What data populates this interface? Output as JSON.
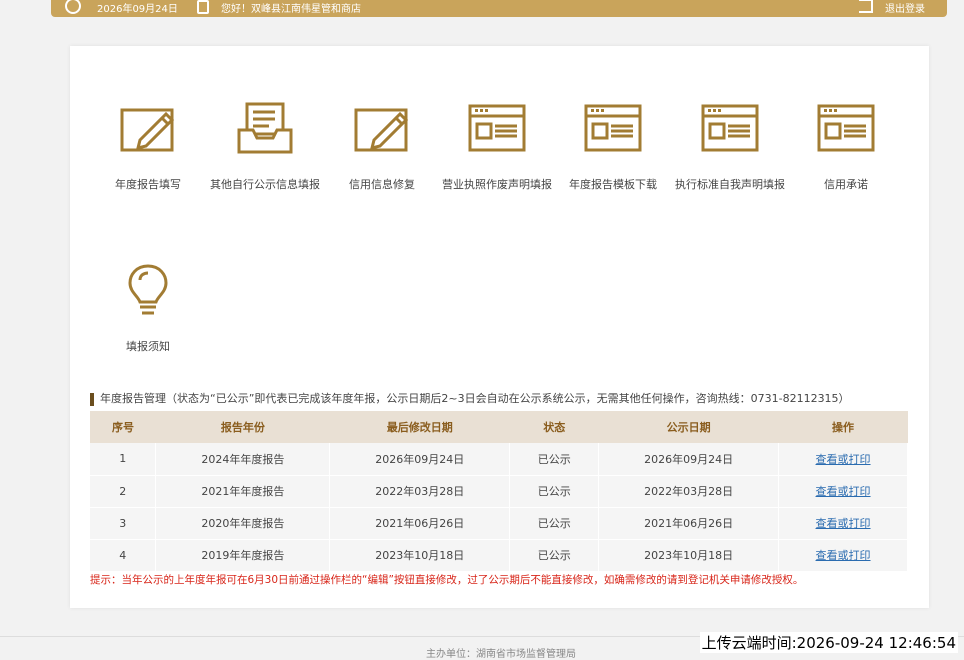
{
  "topbar": {
    "date": "2026年09月24日",
    "welcome": "您好！双峰县江南伟星管和商店",
    "logout": "退出登录"
  },
  "menu": [
    {
      "label": "年度报告填写",
      "icon": "edit-icon"
    },
    {
      "label": "其他自行公示信息填报",
      "icon": "inbox-icon"
    },
    {
      "label": "信用信息修复",
      "icon": "edit-icon"
    },
    {
      "label": "营业执照作废声明填报",
      "icon": "form-window-icon"
    },
    {
      "label": "年度报告模板下载",
      "icon": "form-window-icon"
    },
    {
      "label": "执行标准自我声明填报",
      "icon": "form-window-icon"
    },
    {
      "label": "信用承诺",
      "icon": "form-window-icon"
    },
    {
      "label": "填报须知",
      "icon": "lightbulb-icon"
    }
  ],
  "section_title": "年度报告管理（状态为“已公示”即代表已完成该年度年报，公示日期后2~3日会自动在公示系统公示，无需其他任何操作，咨询热线：0731-82112315）",
  "table": {
    "headers": [
      "序号",
      "报告年份",
      "最后修改日期",
      "状态",
      "公示日期",
      "操作"
    ],
    "rows": [
      [
        "1",
        "2024年年度报告",
        "2026年09月24日",
        "已公示",
        "2026年09月24日",
        "查看或打印"
      ],
      [
        "2",
        "2021年年度报告",
        "2022年03月28日",
        "已公示",
        "2022年03月28日",
        "查看或打印"
      ],
      [
        "3",
        "2020年年度报告",
        "2021年06月26日",
        "已公示",
        "2021年06月26日",
        "查看或打印"
      ],
      [
        "4",
        "2019年年度报告",
        "2023年10月18日",
        "已公示",
        "2023年10月18日",
        "查看或打印"
      ]
    ]
  },
  "hint": "提示：当年公示的上年度年报可在6月30日前通过操作栏的“编辑”按钮直接修改，过了公示期后不能直接修改，如确需修改的请到登记机关申请修改授权。",
  "footer": "主办单位：湖南省市场监督管理局",
  "upload_time": "上传云端时间:2026-09-24 12:46:54",
  "colors": {
    "brand": "#c9a45b",
    "icon": "#a27c33",
    "link": "#2b6cb0",
    "hint": "#d8261a"
  }
}
